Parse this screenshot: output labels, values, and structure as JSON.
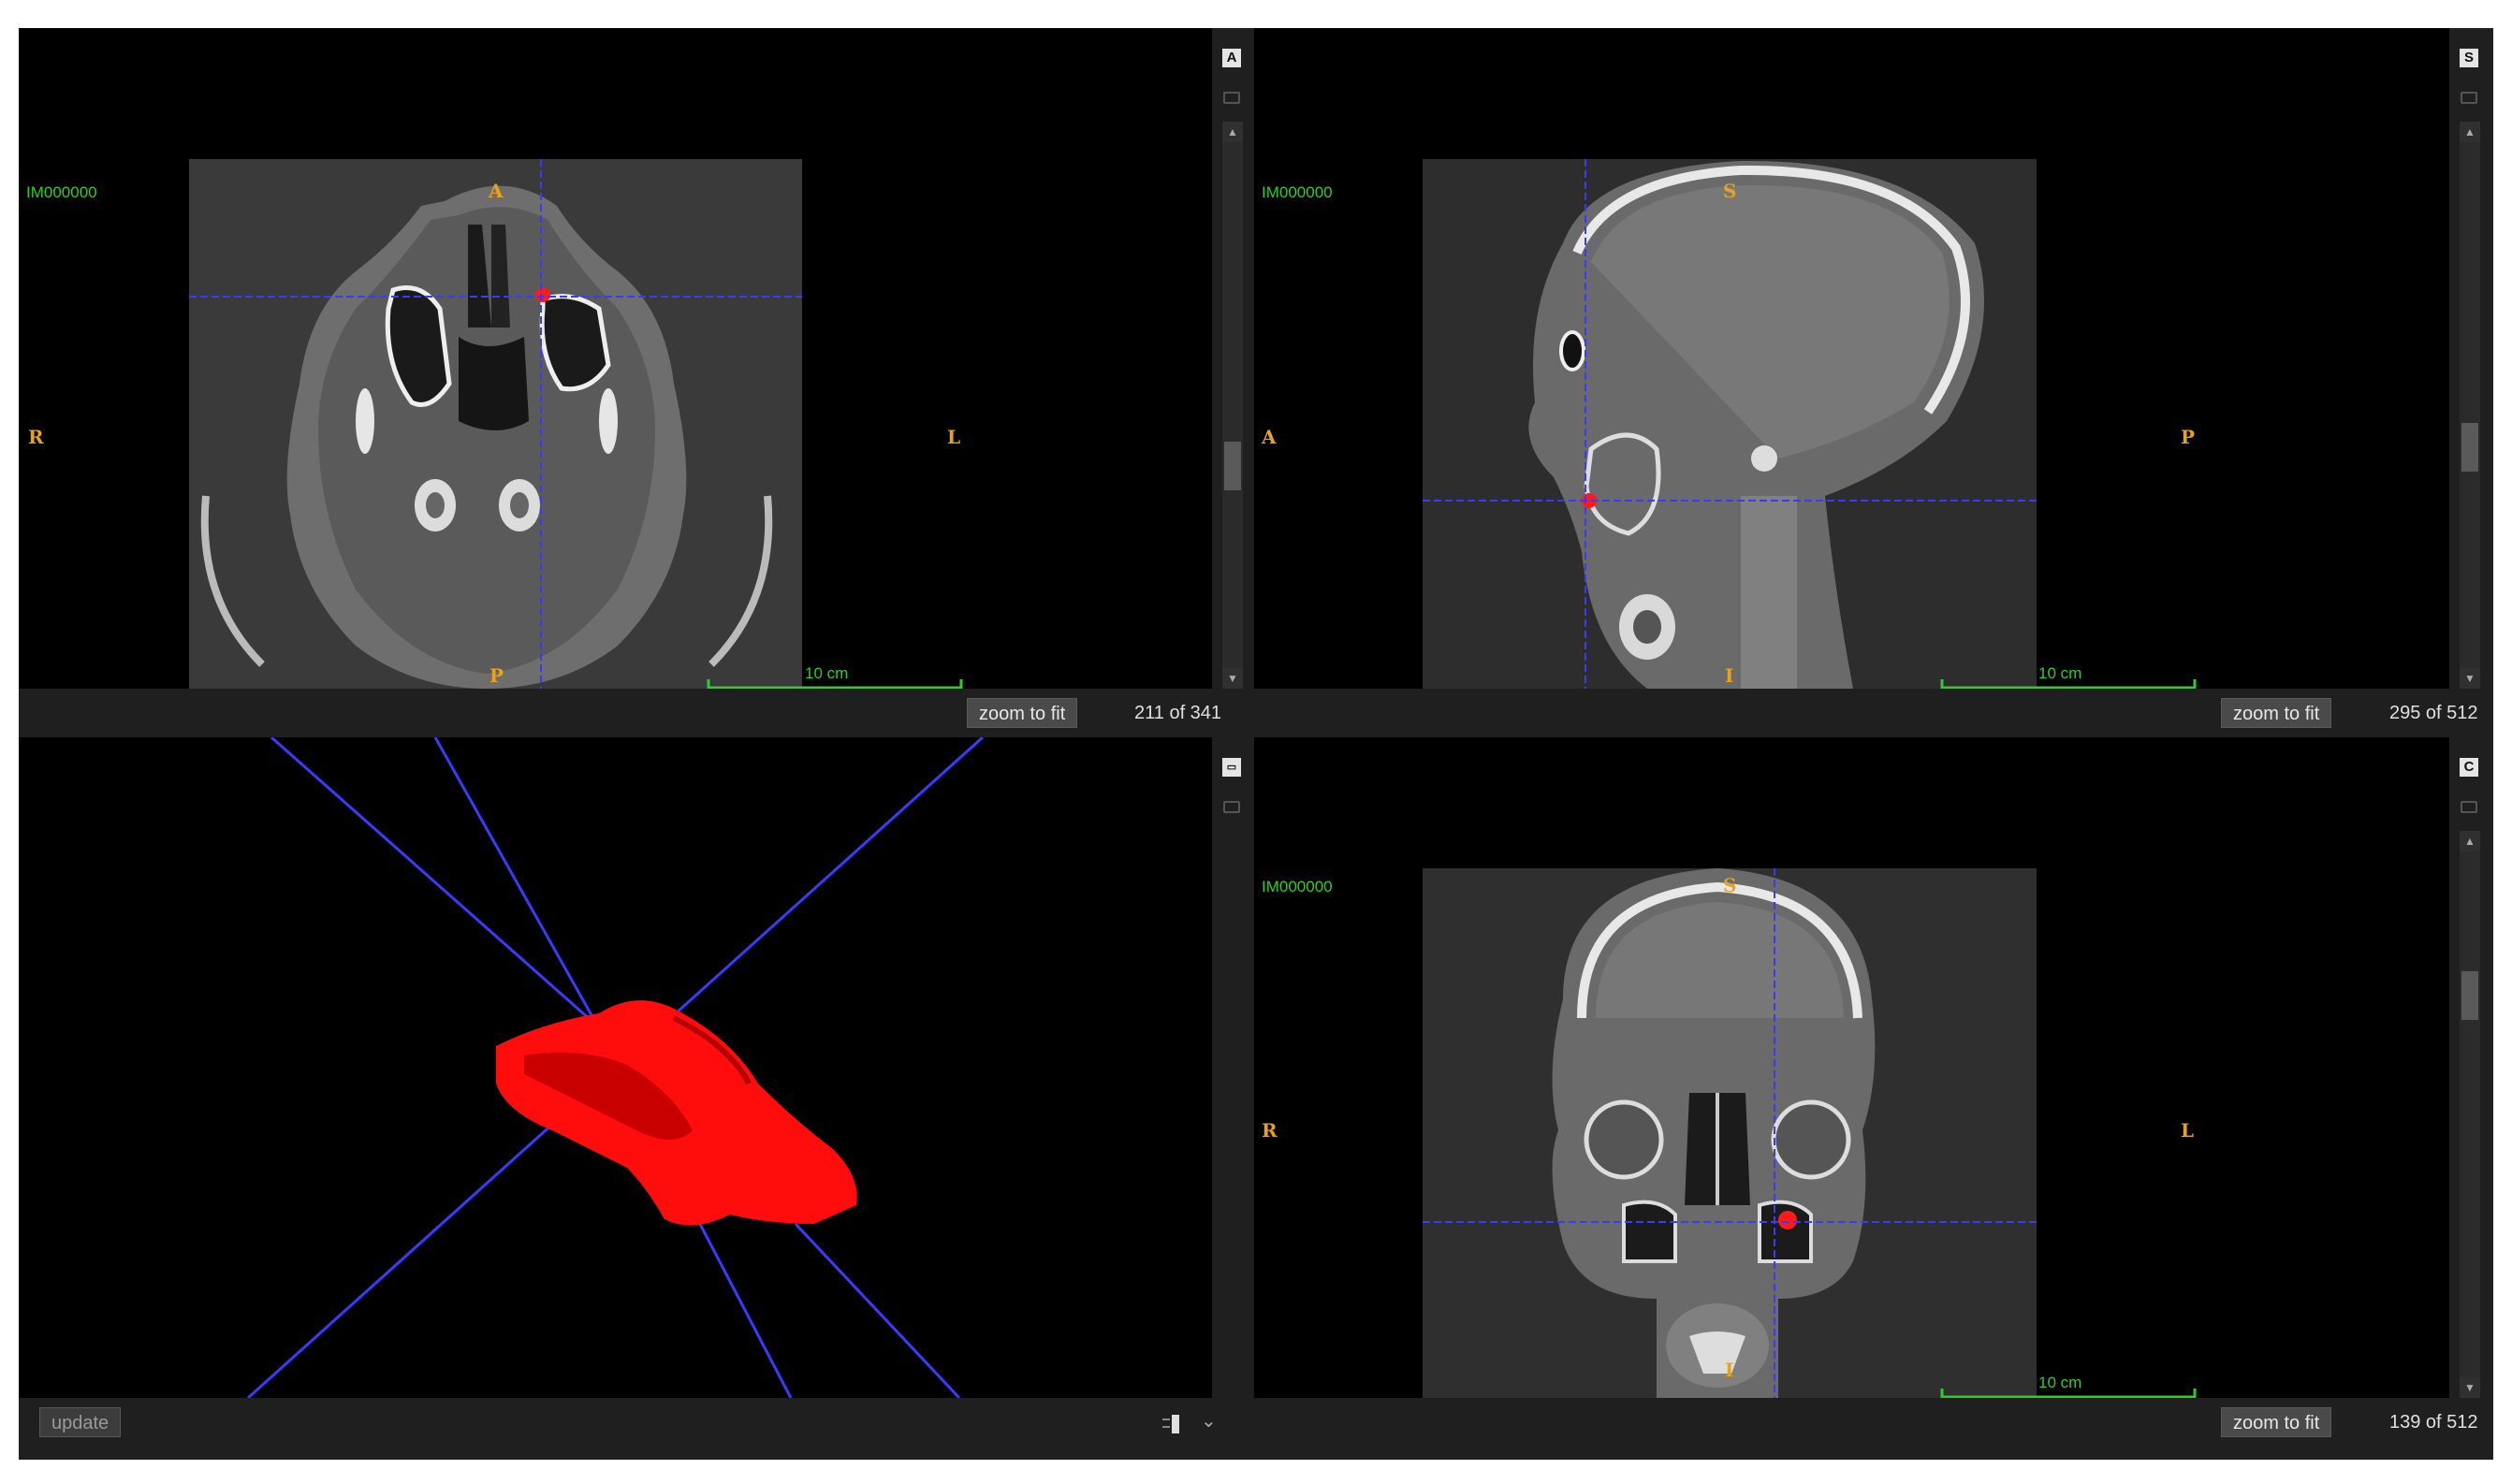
{
  "viewports": {
    "axial": {
      "series_id": "IM000000",
      "orient_top": "A",
      "orient_bottom": "P",
      "orient_left": "R",
      "orient_right": "L",
      "scale_label": "10 cm",
      "slice_text": "211 of 341",
      "zoom_label": "zoom to fit",
      "sidebar_icon": "A"
    },
    "sagittal": {
      "series_id": "IM000000",
      "orient_top": "S",
      "orient_bottom": "I",
      "orient_left": "A",
      "orient_right": "P",
      "scale_label": "10 cm",
      "slice_text": "295 of 512",
      "zoom_label": "zoom to fit",
      "sidebar_icon": "S"
    },
    "render3d": {
      "update_label": "update",
      "sidebar_icon": "3d-view-icon"
    },
    "coronal": {
      "series_id": "IM000000",
      "orient_top": "S",
      "orient_bottom": "I",
      "orient_left": "R",
      "orient_right": "L",
      "scale_label": "10 cm",
      "slice_text": "139 of 512",
      "zoom_label": "zoom to fit",
      "sidebar_icon": "C"
    }
  },
  "colors": {
    "background": "#000000",
    "panel": "#1f1f1f",
    "orientation_label": "#e8a21c",
    "annotation": "#2ecc2e",
    "crosshair": "#3a3aff",
    "segmentation": "#ff1a1a"
  }
}
